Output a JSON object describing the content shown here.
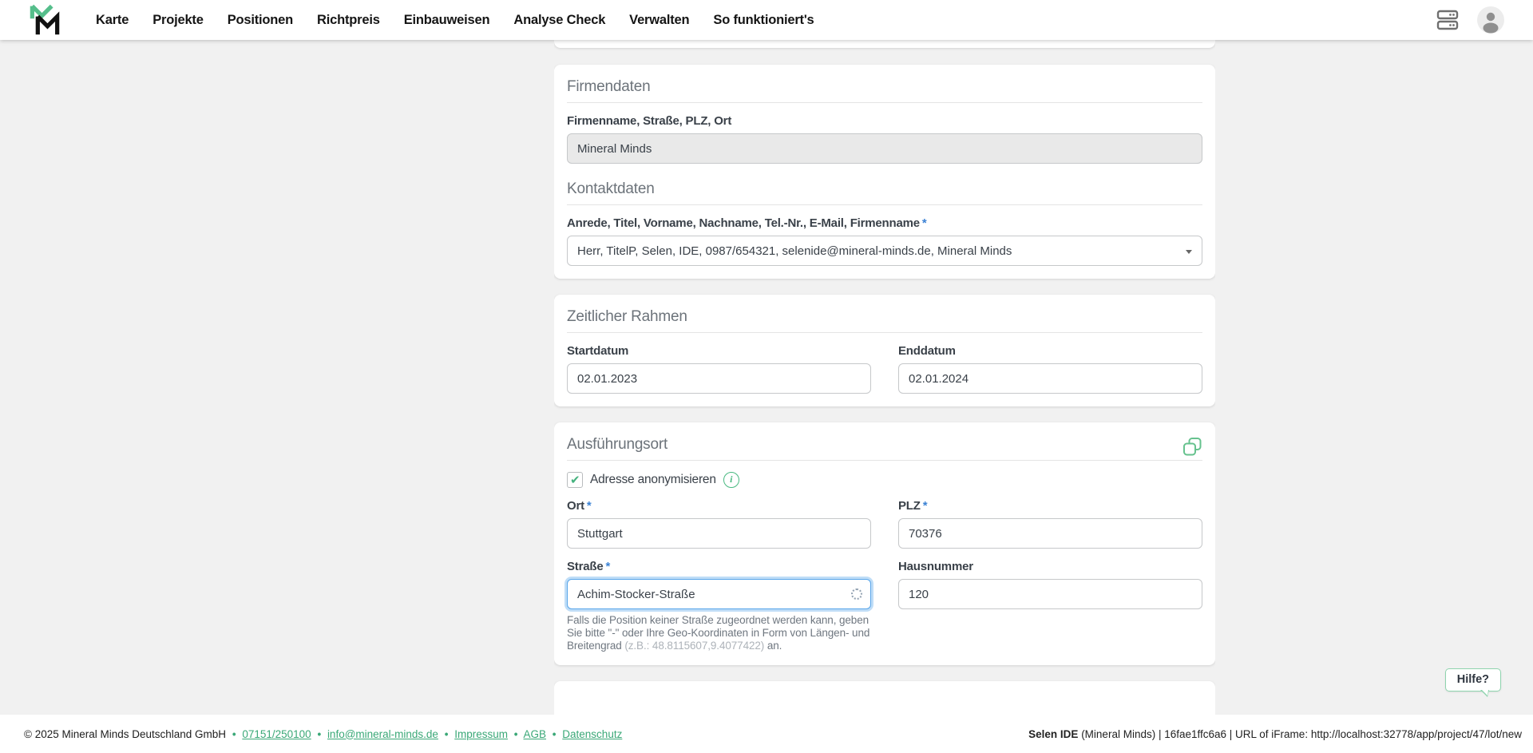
{
  "nav": {
    "items": [
      "Karte",
      "Projekte",
      "Positionen",
      "Richtpreis",
      "Einbauweisen",
      "Analyse Check",
      "Verwalten",
      "So funktioniert's"
    ]
  },
  "required_marker": "*",
  "firmendaten": {
    "title": "Firmendaten",
    "company_label": "Firmenname, Straße, PLZ, Ort",
    "company_value": "Mineral Minds",
    "kontakt_title": "Kontaktdaten",
    "contact_label": "Anrede, Titel, Vorname, Nachname, Tel.-Nr., E-Mail, Firmenname",
    "contact_value": "Herr, TitelP, Selen, IDE, 0987/654321, selenide@mineral-minds.de, Mineral Minds"
  },
  "zeitraum": {
    "title": "Zeitlicher Rahmen",
    "start_label": "Startdatum",
    "start_value": "02.01.2023",
    "end_label": "Enddatum",
    "end_value": "02.01.2024"
  },
  "ort": {
    "title": "Ausführungsort",
    "anonymize_label": "Adresse anonymisieren",
    "city_label": "Ort",
    "city_value": "Stuttgart",
    "plz_label": "PLZ",
    "plz_value": "70376",
    "street_label": "Straße",
    "street_value": "Achim-Stocker-Straße",
    "number_label": "Hausnummer",
    "number_value": "120",
    "help_part1": "Falls die Position keiner Straße zugeordnet werden kann, geben Sie bitte \"-\" oder Ihre Geo-Koordinaten in Form von Längen- und Breitengrad ",
    "help_example": "(z.B.: 48.8115607,9.4077422)",
    "help_part2": " an."
  },
  "help_button": "Hilfe?",
  "footer": {
    "copyright": "© 2025 Mineral Minds Deutschland GmbH",
    "sep": "•",
    "phone": "07151/250100",
    "email": "info@mineral-minds.de",
    "impressum": "Impressum",
    "agb": "AGB",
    "datenschutz": "Datenschutz",
    "status_bold": "Selen IDE",
    "status_rest": " (Mineral Minds) | 16fae1ffc6a6 | URL of iFrame: http://localhost:32778/app/project/47/lot/new"
  },
  "colors": {
    "accent_green": "#4db380",
    "link_green": "#3aa877",
    "required_blue": "#3b82d4",
    "focus_blue": "#57a5ea",
    "page_bg": "#f1f1f1"
  }
}
